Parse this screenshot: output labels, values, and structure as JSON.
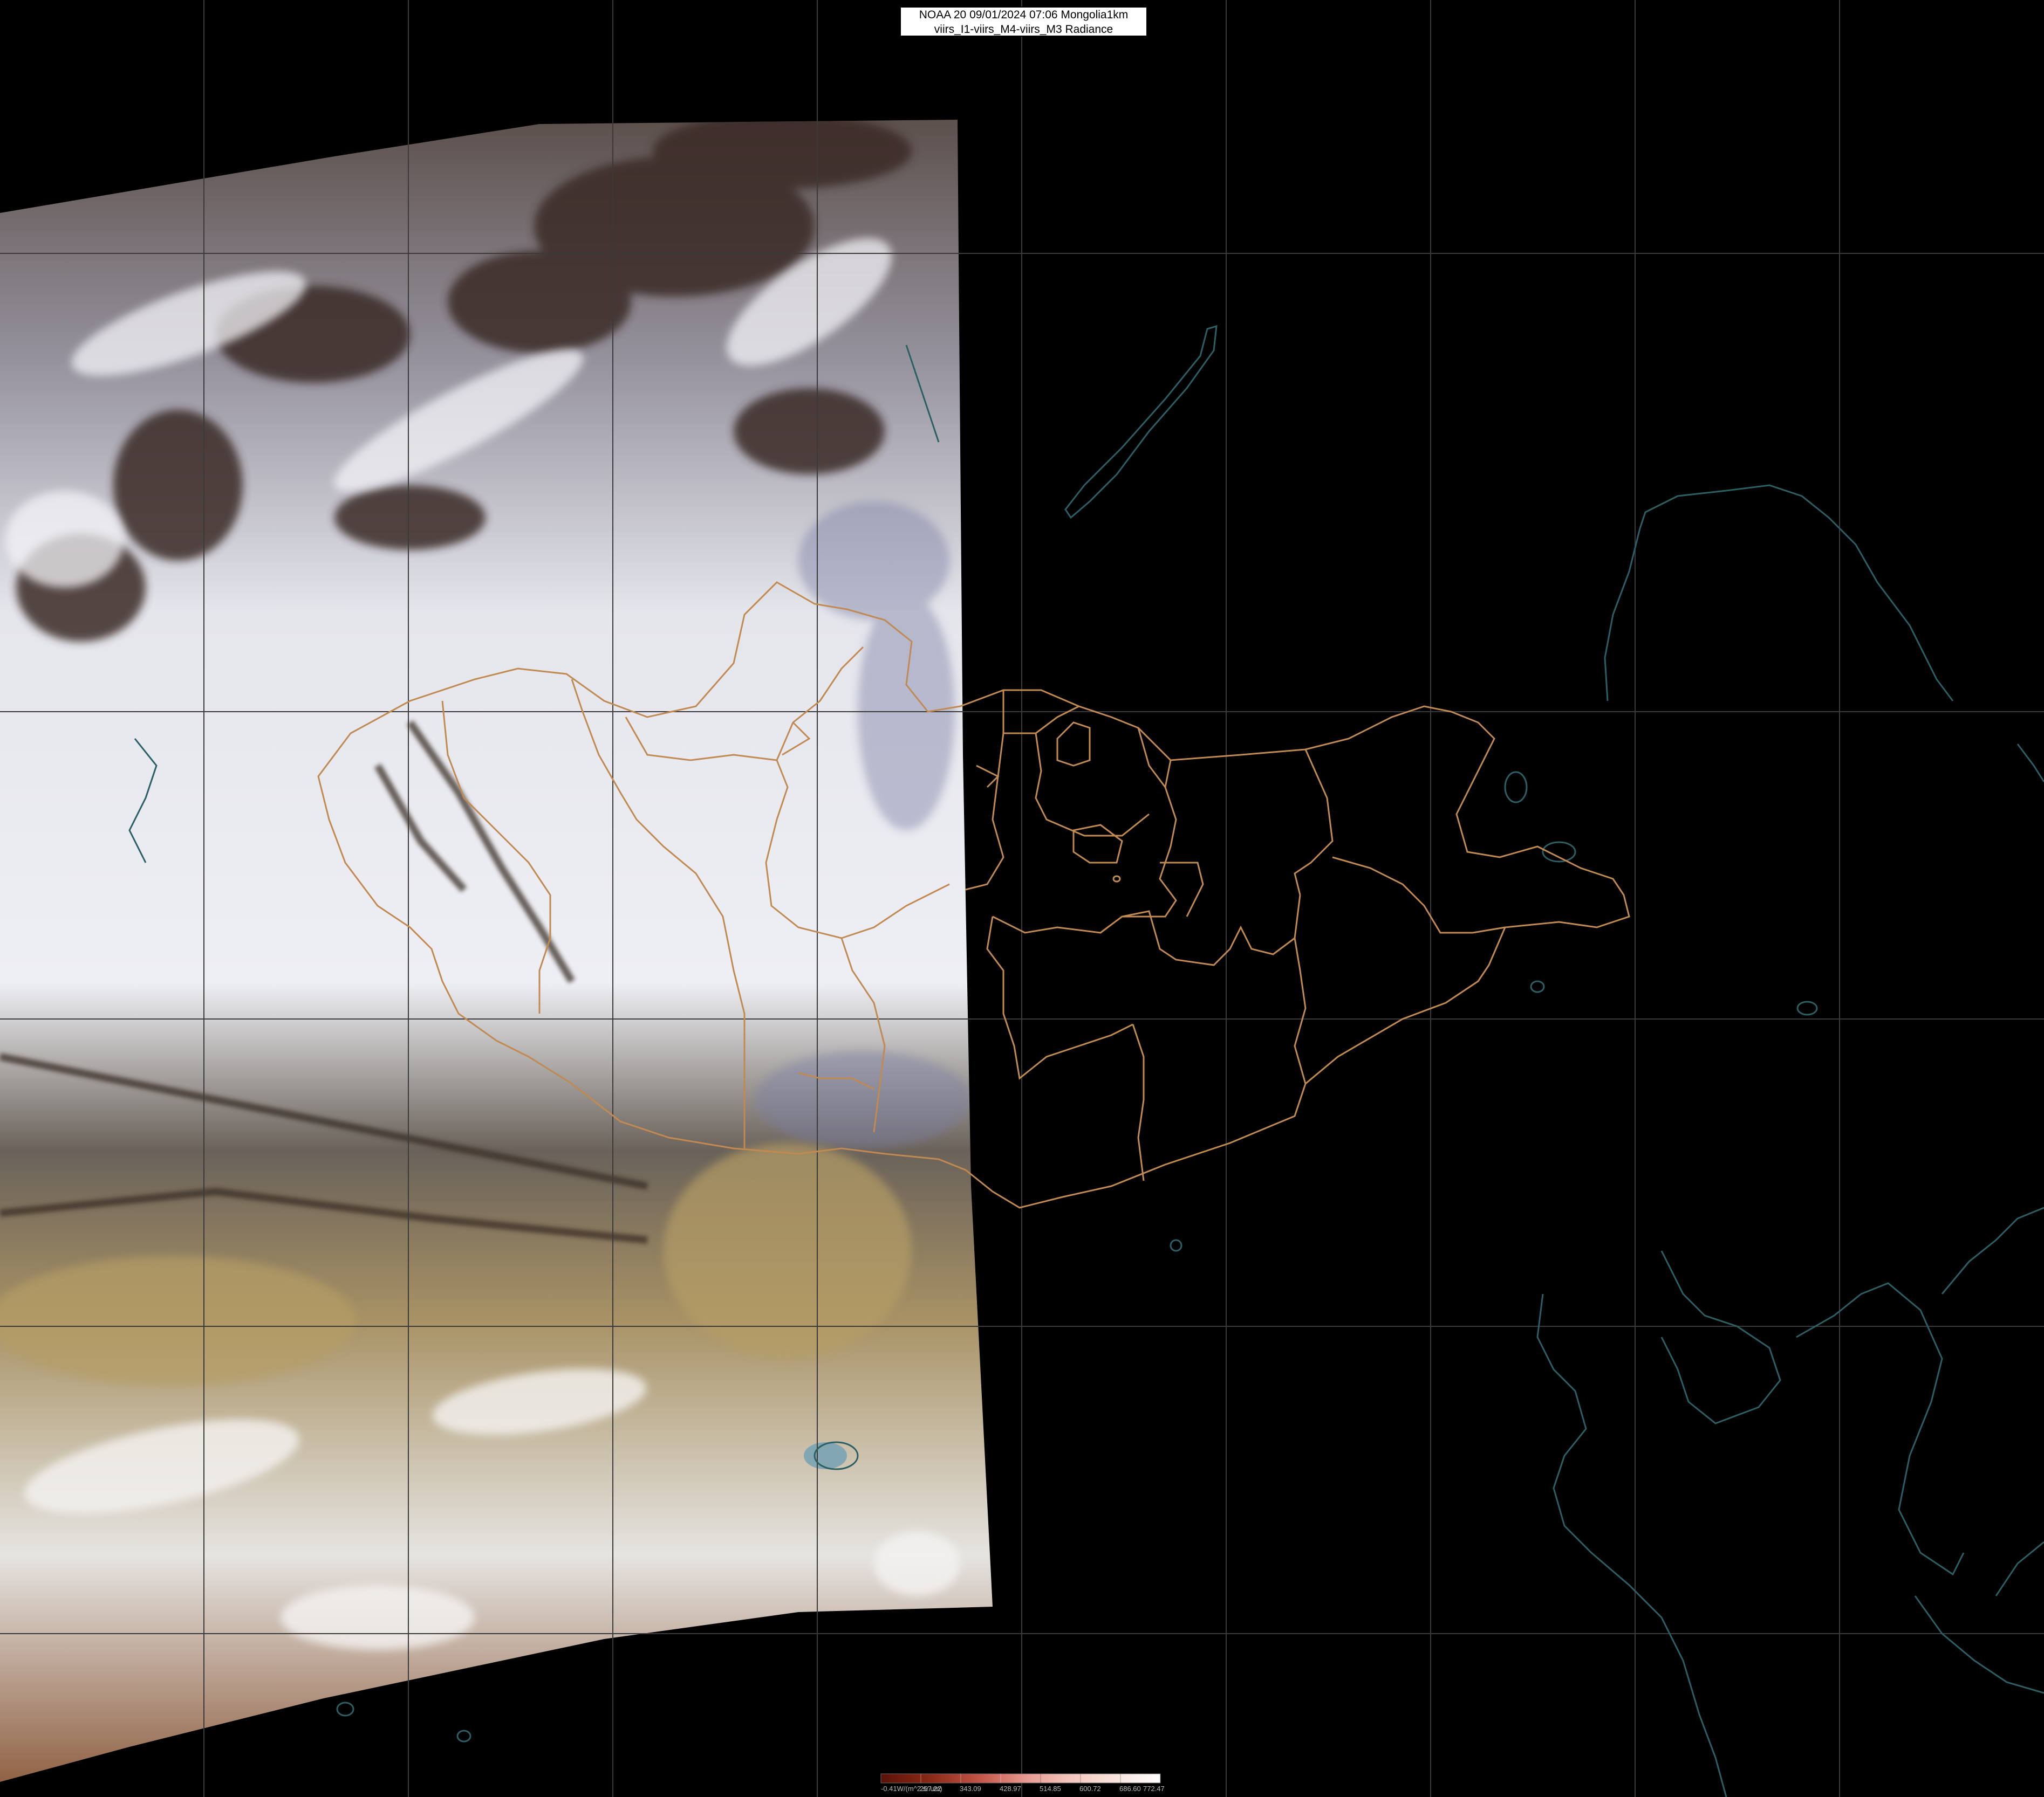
{
  "title": {
    "line1": "NOAA 20 09/01/2024 07:06 Mongolia1km",
    "line2": "viirs_I1-viirs_M4-viirs_M3 Radiance"
  },
  "colors": {
    "background": "#000000",
    "grid": "#3a3a3a",
    "coastline": "#2c5f64",
    "admin_border": "#c08a52",
    "cloud": "#e7e9ef",
    "desert": "#a08b5c"
  },
  "colorbar": {
    "unit_label": "-0.41W/(m^2.sr.um)",
    "ticks": [
      "257.22",
      "343.09",
      "428.97",
      "514.85",
      "600.72",
      "686.60",
      "772.47"
    ],
    "gradient": [
      "#5a1208",
      "#8b2a17",
      "#c4574a",
      "#e79a91",
      "#f4c7bf",
      "#f8e4dd",
      "#ffffff"
    ]
  }
}
